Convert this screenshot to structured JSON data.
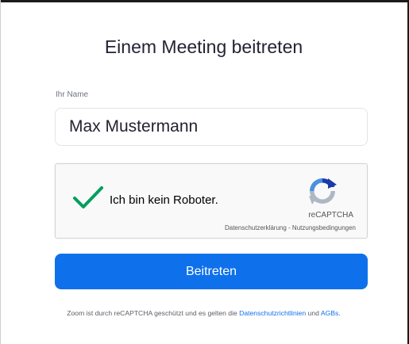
{
  "join": {
    "title": "Einem Meeting beitreten",
    "name_label": "Ihr Name",
    "name_value": "Max Mustermann",
    "button_label": "Beitreten"
  },
  "recaptcha": {
    "label": "Ich bin kein Roboter.",
    "checked": true,
    "brand": "reCAPTCHA",
    "privacy_link": "Datenschutzerklärung",
    "separator": " - ",
    "terms_link": "Nutzungsbedingungen",
    "check_color": "#029f5b",
    "logo_colors": [
      "#1c3aa9",
      "#4a90e2",
      "#aeb8c4"
    ]
  },
  "footer": {
    "text_before": "Zoom ist durch reCAPTCHA geschützt und es gelten die ",
    "privacy_link": "Datenschutzrichtlinien",
    "and": " und ",
    "terms_link": "AGBs",
    "period": "."
  },
  "colors": {
    "accent": "#0e71eb",
    "title_text": "#232333"
  }
}
